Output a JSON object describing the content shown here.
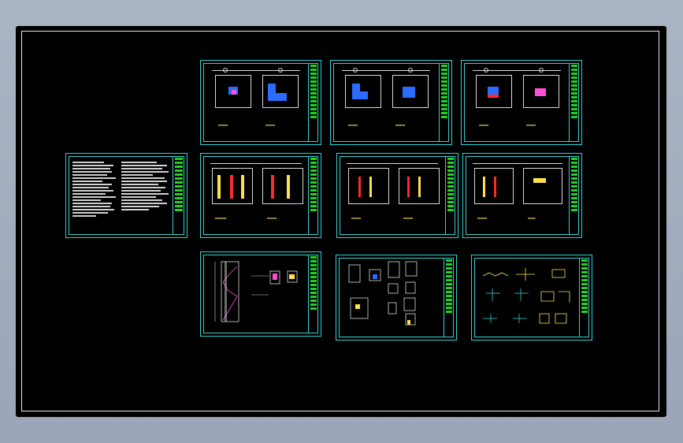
{
  "drawing": {
    "background": "#000000",
    "sheet_color": "#2fd3d3",
    "titleblock_color": "#1fd31f",
    "accent_colors": [
      "#ffe14a",
      "#2b6cff",
      "#ff4fd8",
      "#ff2a2a"
    ]
  },
  "sheets": [
    {
      "id": "notes-sheet",
      "kind": "general-notes"
    },
    {
      "id": "plan-sheet-1",
      "kind": "floor-plans"
    },
    {
      "id": "plan-sheet-2",
      "kind": "floor-plans"
    },
    {
      "id": "plan-sheet-3",
      "kind": "floor-plans"
    },
    {
      "id": "plan-sheet-4",
      "kind": "structure-plans"
    },
    {
      "id": "plan-sheet-5",
      "kind": "structure-plans"
    },
    {
      "id": "plan-sheet-6",
      "kind": "structure-plans"
    },
    {
      "id": "stair-sheet",
      "kind": "section-details"
    },
    {
      "id": "detail-sheet-1",
      "kind": "details"
    },
    {
      "id": "detail-sheet-2",
      "kind": "details"
    }
  ]
}
